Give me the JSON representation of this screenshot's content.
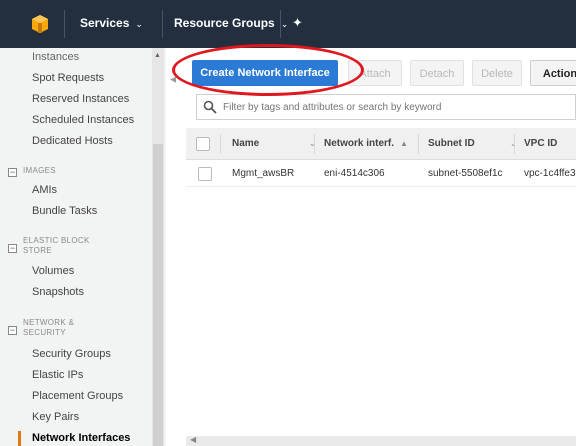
{
  "topbar": {
    "services_label": "Services",
    "resource_groups_label": "Resource Groups",
    "caret": "⌄",
    "pin_glyph": "✦"
  },
  "sidebar": {
    "instances_partial": "Instances",
    "items_top": [
      "Spot Requests",
      "Reserved Instances",
      "Scheduled Instances",
      "Dedicated Hosts"
    ],
    "images_header": "IMAGES",
    "images_items": [
      "AMIs",
      "Bundle Tasks"
    ],
    "ebs_header_1": "ELASTIC BLOCK",
    "ebs_header_2": "STORE",
    "ebs_items": [
      "Volumes",
      "Snapshots"
    ],
    "netsec_header_1": "NETWORK &",
    "netsec_header_2": "SECURITY",
    "netsec_items": [
      "Security Groups",
      "Elastic IPs",
      "Placement Groups",
      "Key Pairs",
      "Network Interfaces"
    ],
    "collapse_glyph": "−"
  },
  "toolbar": {
    "create_label": "Create Network Interface",
    "attach_label": "Attach",
    "detach_label": "Detach",
    "delete_label": "Delete",
    "actions_label": "Action"
  },
  "filter": {
    "placeholder": "Filter by tags and attributes or search by keyword"
  },
  "table": {
    "columns": [
      "Name",
      "Network interf.",
      "Subnet ID",
      "VPC ID"
    ],
    "rows": [
      [
        "Mgmt_awsBR",
        "eni-4514c306",
        "subnet-5508ef1c",
        "vpc-1c4ffe3"
      ]
    ]
  },
  "colors": {
    "nav_bg": "#232f3e",
    "primary_button": "#2b7bd6",
    "highlight_ellipse": "#e0171e",
    "active_marker": "#e47911"
  }
}
